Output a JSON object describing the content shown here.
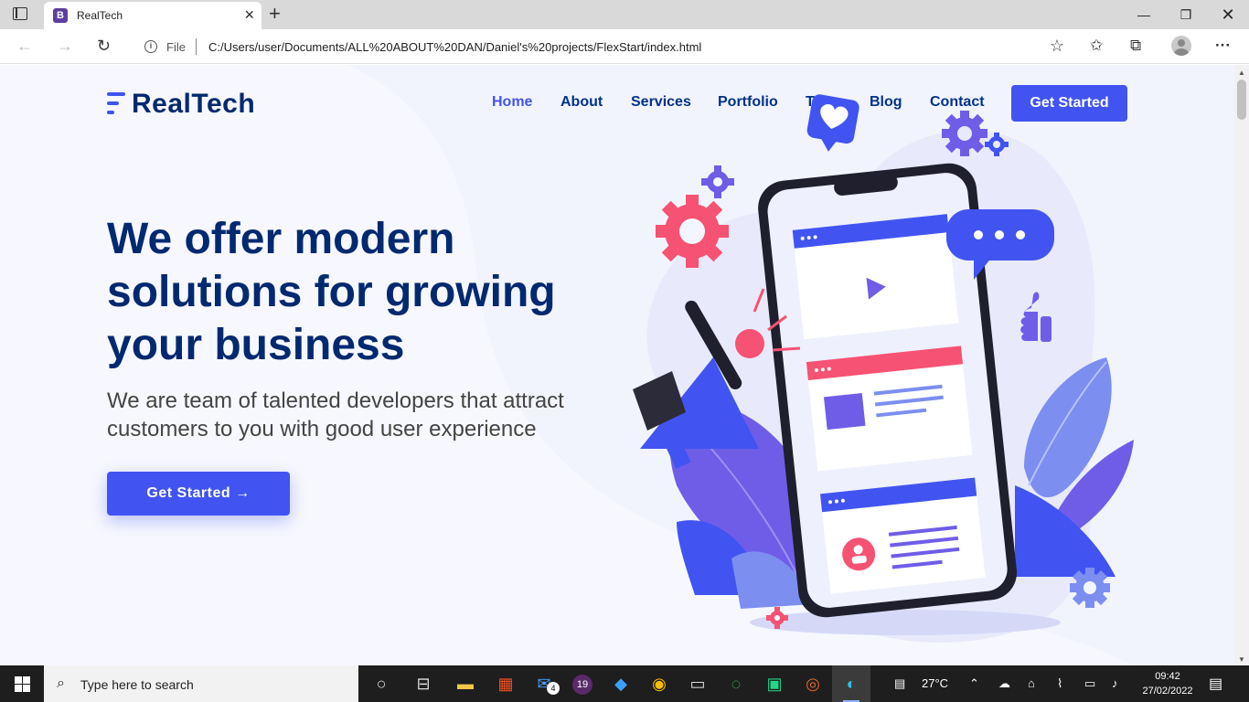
{
  "browser": {
    "tab_title": "RealTech",
    "tab_favicon_letter": "B",
    "address_scheme_label": "File",
    "address_url": "C:/Users/user/Documents/ALL%20ABOUT%20DAN/Daniel's%20projects/FlexStart/index.html"
  },
  "site": {
    "logo_text": "RealTech",
    "nav": [
      "Home",
      "About",
      "Services",
      "Portfolio",
      "Team",
      "Blog",
      "Contact"
    ],
    "nav_active": "Home",
    "nav_cta": "Get Started",
    "hero": {
      "title": "We offer modern solutions for growing your business",
      "subtitle": "We are team of talented developers that attract customers to you with good user experience",
      "cta": "Get Started →"
    },
    "colors": {
      "primary": "#4154f1",
      "navy": "#012970",
      "nav_text": "#013289",
      "page_bg": "#f4f6ff",
      "accent_pink": "#f65273"
    }
  },
  "taskbar": {
    "search_placeholder": "Type here to search",
    "weather": "27°C",
    "time": "09:42",
    "date": "27/02/2022",
    "mail_badge": "4",
    "app19_label": "19"
  }
}
